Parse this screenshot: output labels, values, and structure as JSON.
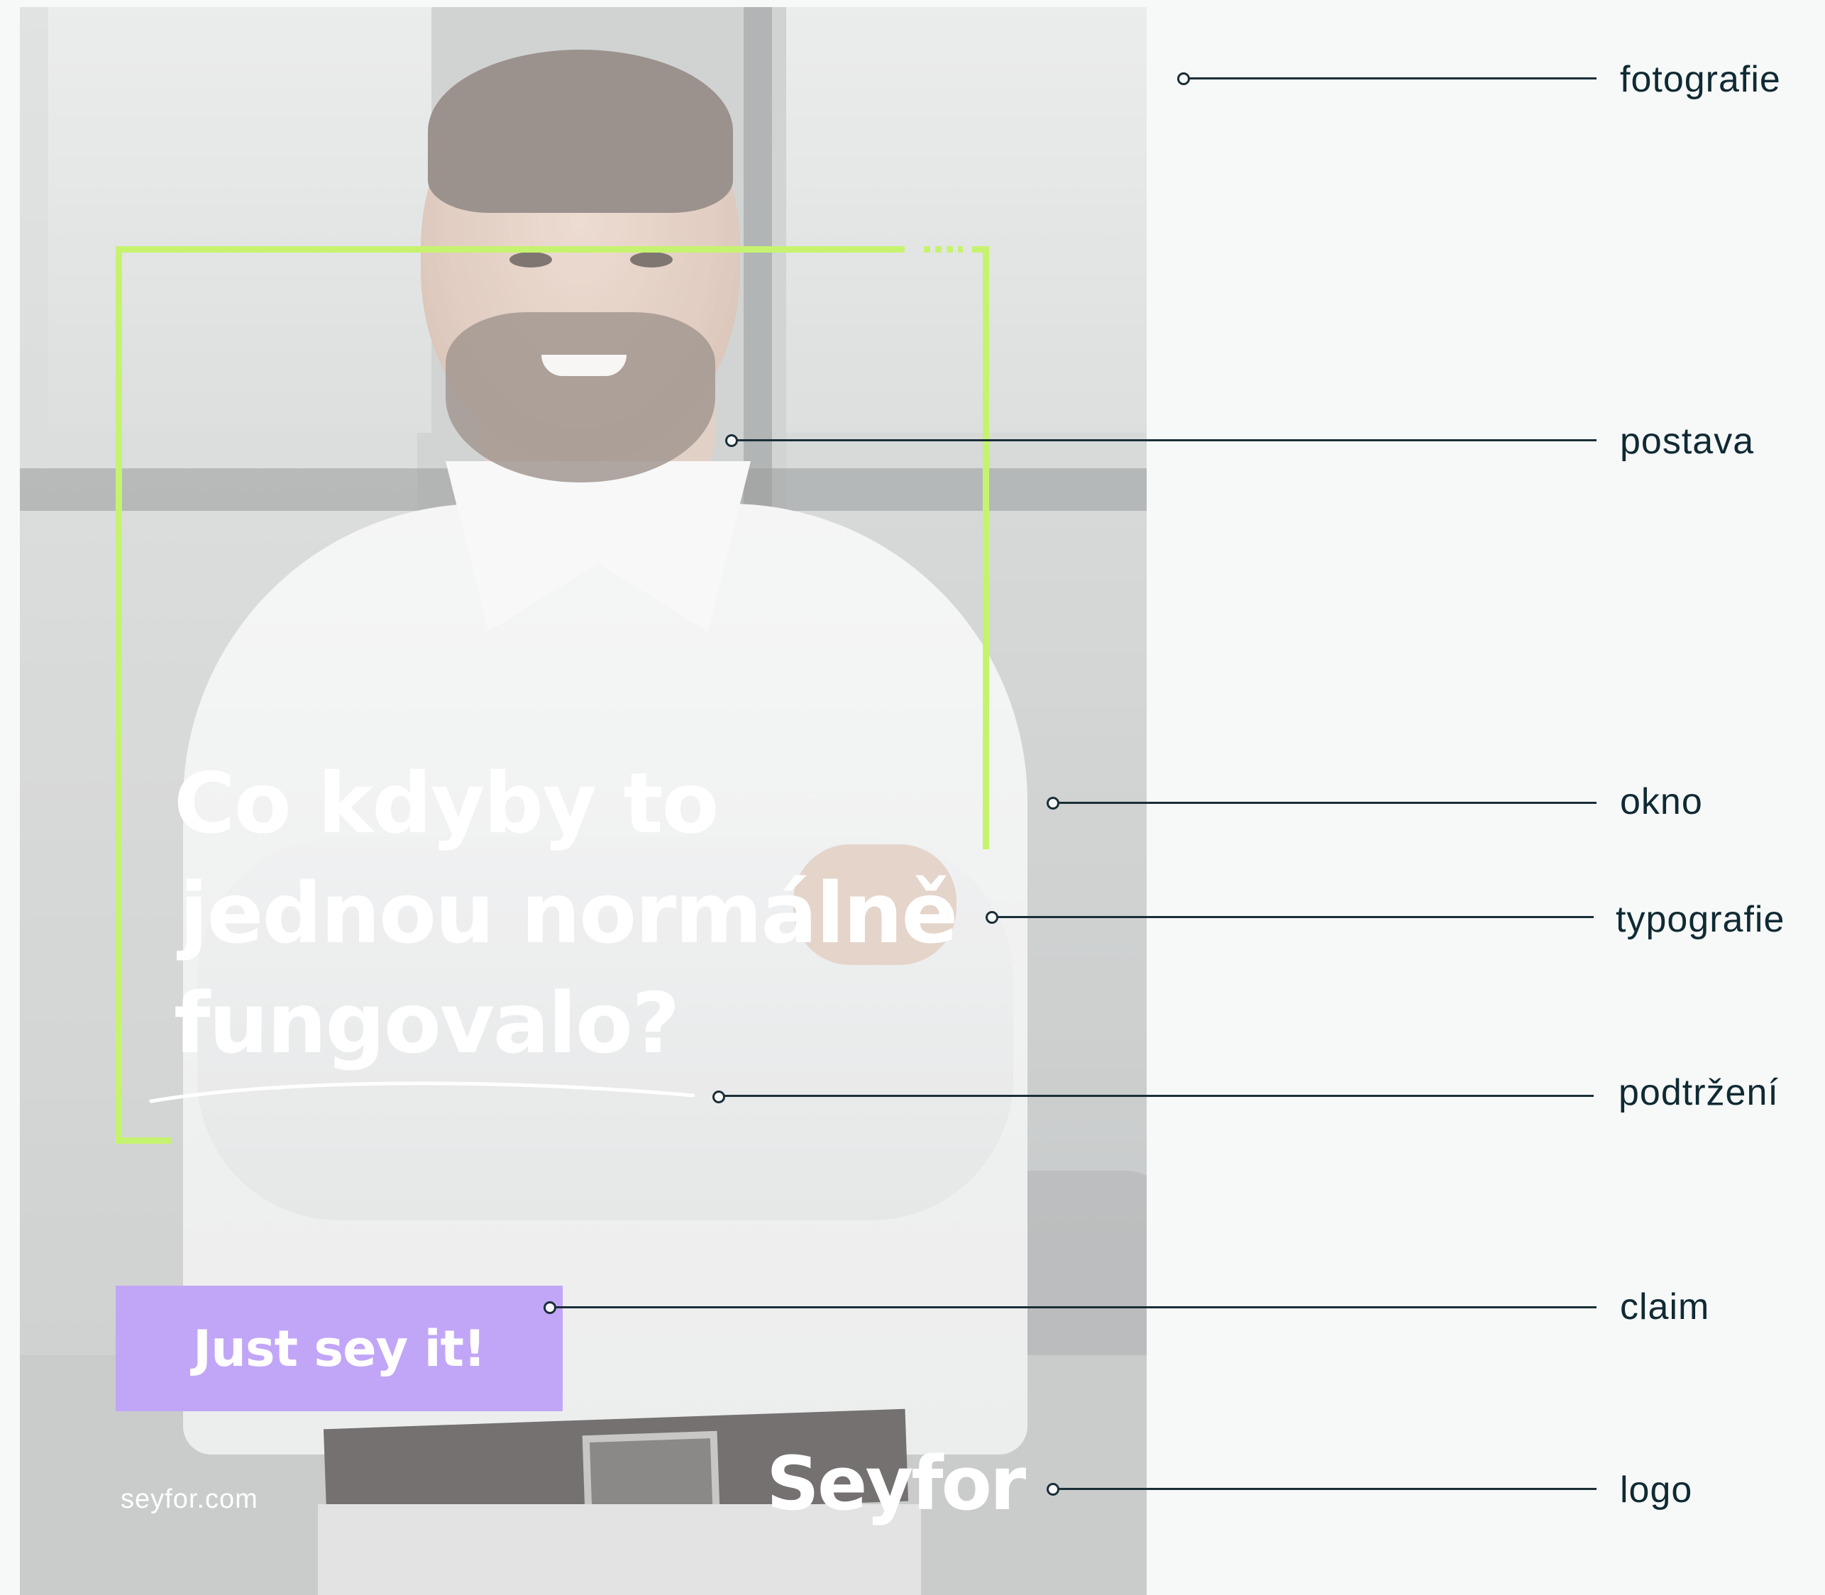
{
  "poster": {
    "headline": [
      "Co kdyby to",
      "jednou normálně",
      "fungovalo?"
    ],
    "claim": "Just sey it!",
    "url": "seyfor.com",
    "logo_text": "Seyfor",
    "colors": {
      "frame_accent": "#c6f36f",
      "claim_background": "#c1a6f7",
      "text": "#ffffff",
      "annotation": "#1a2f38"
    }
  },
  "annotations": [
    {
      "label": "fotografie"
    },
    {
      "label": "postava"
    },
    {
      "label": "okno"
    },
    {
      "label": "typografie"
    },
    {
      "label": "podtržení"
    },
    {
      "label": "claim"
    },
    {
      "label": "logo"
    }
  ]
}
